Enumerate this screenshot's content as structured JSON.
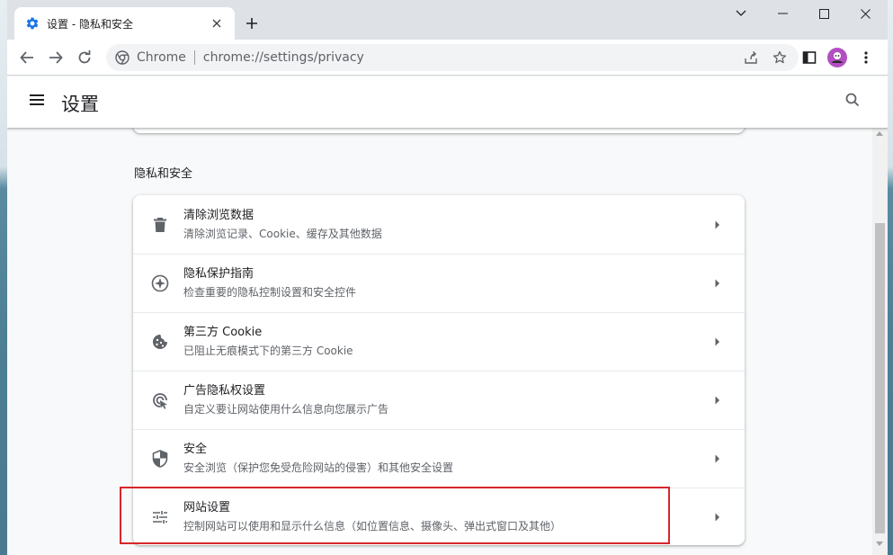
{
  "tab": {
    "title": "设置 - 隐私和安全",
    "close_icon": "close-icon",
    "favicon": "settings-gear-icon"
  },
  "omnibox": {
    "chip": "Chrome",
    "url": "chrome://settings/privacy"
  },
  "header": {
    "title": "设置"
  },
  "section": {
    "title": "隐私和安全"
  },
  "rows": [
    {
      "title": "清除浏览数据",
      "subtitle": "清除浏览记录、Cookie、缓存及其他数据",
      "icon": "trash-icon"
    },
    {
      "title": "隐私保护指南",
      "subtitle": "检查重要的隐私控制设置和安全控件",
      "icon": "compass-icon"
    },
    {
      "title": "第三方 Cookie",
      "subtitle": "已阻止无痕模式下的第三方 Cookie",
      "icon": "cookie-icon"
    },
    {
      "title": "广告隐私权设置",
      "subtitle": "自定义要让网站使用什么信息向您展示广告",
      "icon": "ad-privacy-icon"
    },
    {
      "title": "安全",
      "subtitle": "安全浏览（保护您免受危险网站的侵害）和其他安全设置",
      "icon": "shield-icon"
    },
    {
      "title": "网站设置",
      "subtitle": "控制网站可以使用和显示什么信息（如位置信息、摄像头、弹出式窗口及其他）",
      "icon": "tune-icon"
    }
  ],
  "colors": {
    "accent": "#1a73e8",
    "highlight_border": "#d9262c",
    "avatar": "#b24fc2"
  }
}
